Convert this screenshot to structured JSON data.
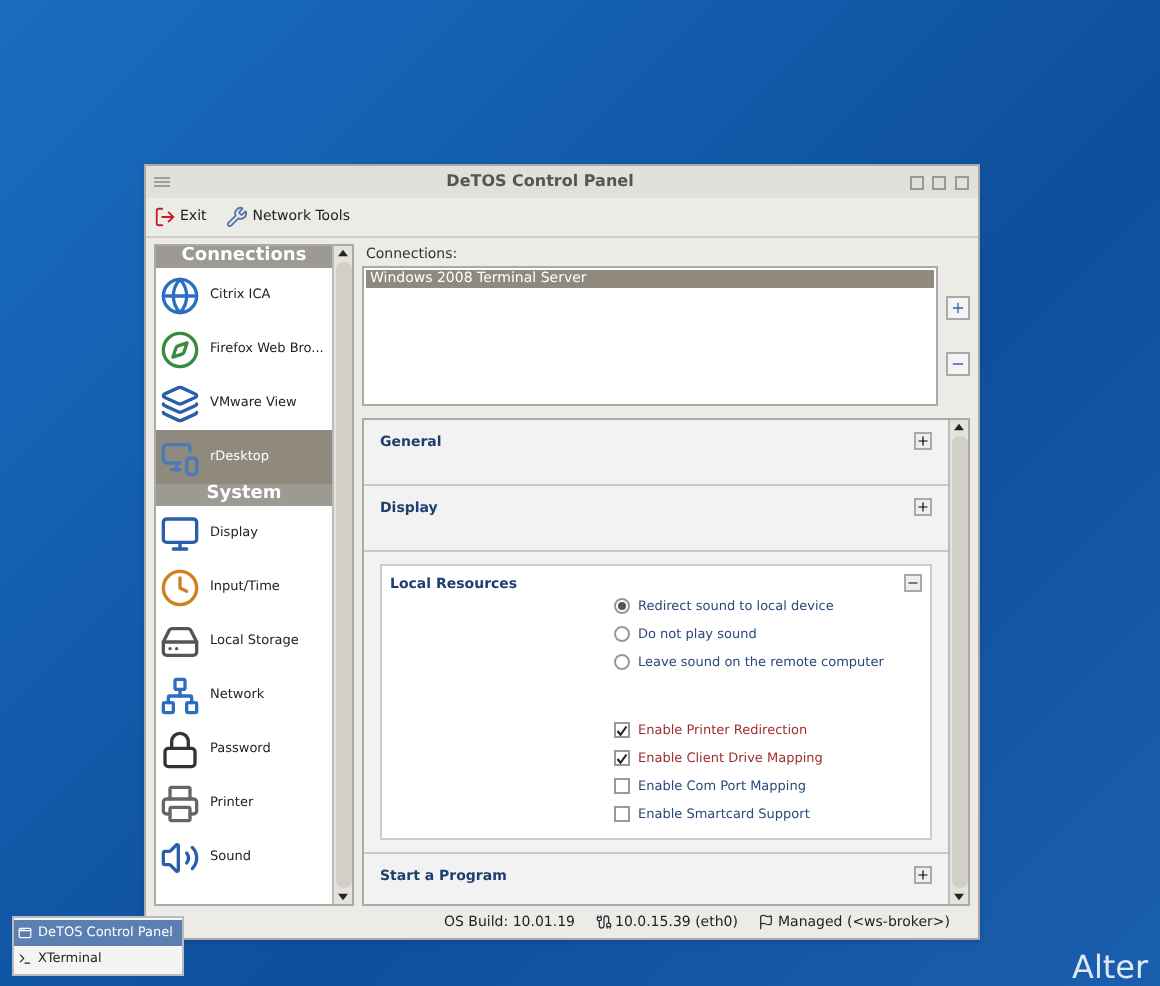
{
  "window": {
    "title": "DeTOS Control Panel"
  },
  "toolbar": [
    {
      "label": "Exit"
    },
    {
      "label": "Network Tools"
    }
  ],
  "sidebar": [
    {
      "title": "Connections",
      "items": [
        {
          "label": "Citrix ICA",
          "selected": false
        },
        {
          "label": "Firefox Web Bro...",
          "selected": false
        },
        {
          "label": "VMware View",
          "selected": false
        },
        {
          "label": "rDesktop",
          "selected": true
        }
      ]
    },
    {
      "title": "System",
      "items": [
        {
          "label": "Display",
          "selected": false
        },
        {
          "label": "Input/Time",
          "selected": false
        },
        {
          "label": "Local Storage",
          "selected": false
        },
        {
          "label": "Network",
          "selected": false
        },
        {
          "label": "Password",
          "selected": false
        },
        {
          "label": "Printer",
          "selected": false
        },
        {
          "label": "Sound",
          "selected": false
        }
      ]
    }
  ],
  "connections": {
    "label": "Connections:",
    "items": [
      {
        "label": "Windows 2008 Terminal Server",
        "selected": true
      }
    ]
  },
  "sections": [
    {
      "title": "General",
      "expanded": false
    },
    {
      "title": "Display",
      "expanded": false
    },
    {
      "title": "Local Resources",
      "expanded": true,
      "options": [
        {
          "kind": "radio",
          "label": "Redirect sound to local device",
          "selected": true
        },
        {
          "kind": "radio",
          "label": "Do not play sound",
          "selected": false
        },
        {
          "kind": "radio",
          "label": "Leave sound on the remote computer",
          "selected": false
        },
        {
          "kind": "checkbox",
          "label": "Enable Printer Redirection",
          "checked": true
        },
        {
          "kind": "checkbox",
          "label": "Enable Client Drive Mapping",
          "checked": true
        },
        {
          "kind": "checkbox",
          "label": "Enable Com Port Mapping",
          "checked": false
        },
        {
          "kind": "checkbox",
          "label": "Enable Smartcard Support",
          "checked": false
        }
      ]
    },
    {
      "title": "Start a Program",
      "expanded": false
    }
  ],
  "status_bar": {
    "os_build": "OS Build: 10.01.19",
    "ip": "10.0.15.39 (eth0)",
    "managed": "Managed (<ws-broker>)"
  },
  "taskbar_menu": [
    {
      "label": "DeTOS Control Panel",
      "selected": true
    },
    {
      "label": "XTerminal",
      "selected": false
    }
  ],
  "wallpaper": {
    "text": "Alter"
  }
}
